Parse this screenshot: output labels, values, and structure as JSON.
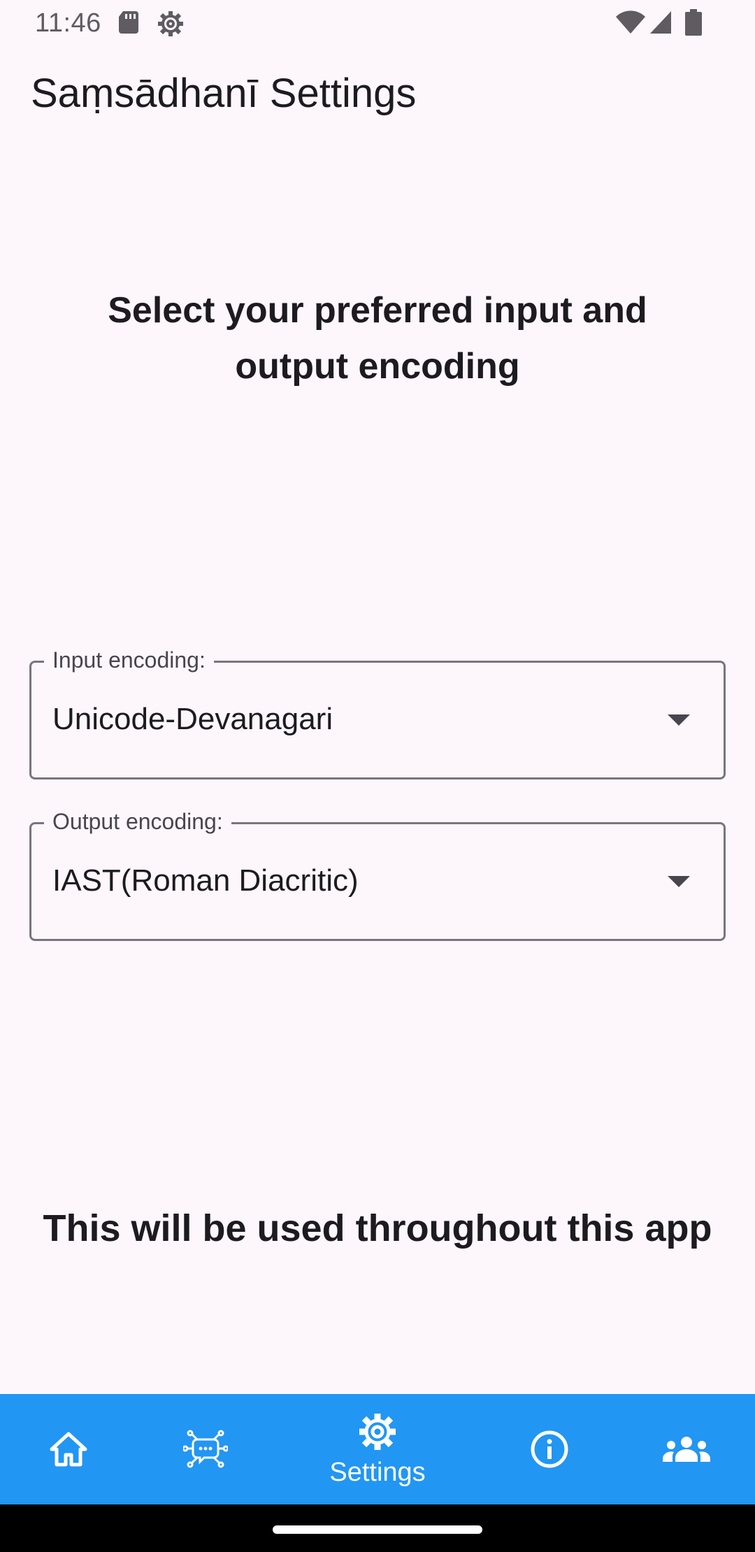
{
  "status_bar": {
    "time": "11:46",
    "icons": [
      "sd-card-icon",
      "settings-icon",
      "wifi-icon",
      "signal-icon",
      "battery-icon"
    ]
  },
  "app_bar": {
    "title": "Saṃsādhanī Settings"
  },
  "content": {
    "heading": "Select your preferred input and output encoding",
    "input_field": {
      "label": "Input encoding:",
      "value": "Unicode-Devanagari"
    },
    "output_field": {
      "label": "Output encoding:",
      "value": "IAST(Roman Diacritic)"
    },
    "footer_note": "This will be used throughout this app"
  },
  "bottom_nav": {
    "items": [
      {
        "icon": "home-icon",
        "label": ""
      },
      {
        "icon": "chatbot-icon",
        "label": ""
      },
      {
        "icon": "settings-icon",
        "label": "Settings",
        "selected": true
      },
      {
        "icon": "info-icon",
        "label": ""
      },
      {
        "icon": "group-icon",
        "label": ""
      }
    ]
  },
  "colors": {
    "background": "#fdf7fb",
    "nav_bar": "#2196f3",
    "nav_icon": "#ffffff",
    "field_border": "#79747e",
    "text": "#1d1b20"
  }
}
